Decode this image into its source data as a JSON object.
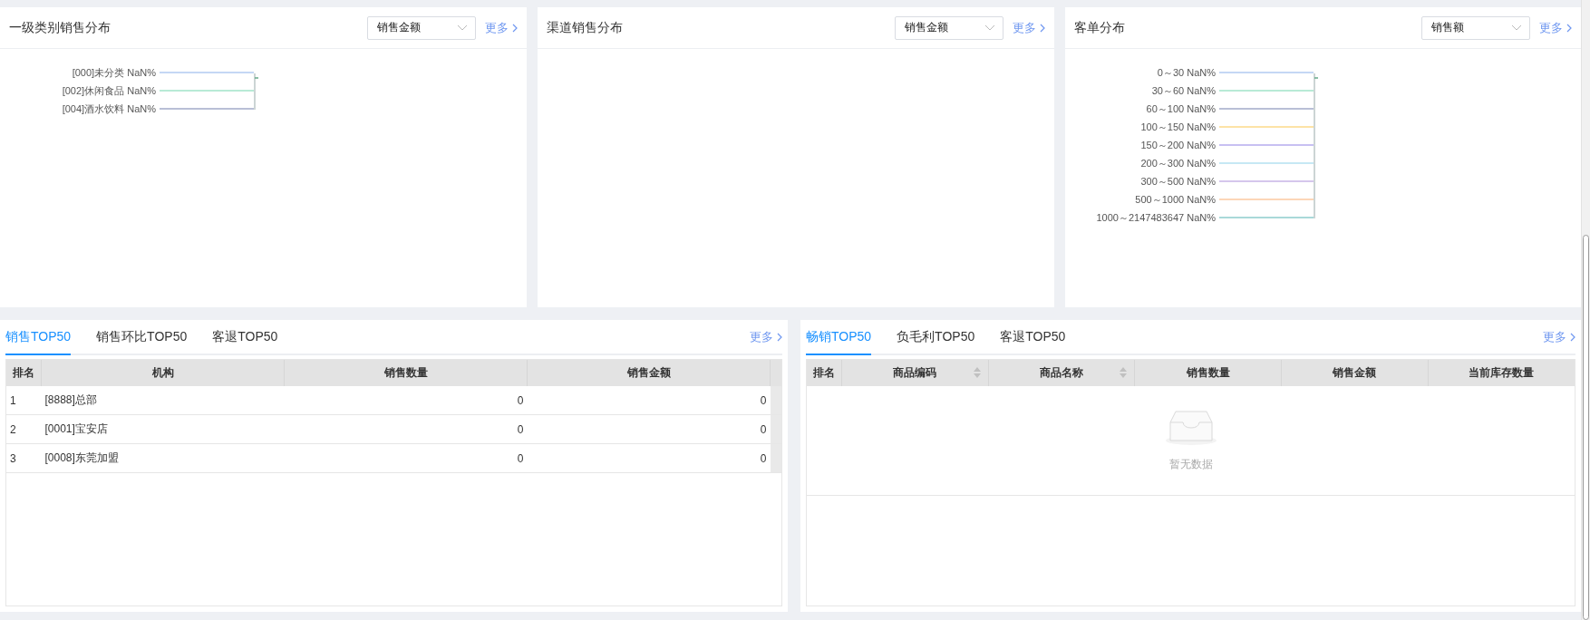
{
  "top_panels": [
    {
      "title": "一级类别销售分布",
      "select": {
        "value": "销售金额"
      },
      "more": "更多",
      "chart_labels": [
        {
          "label": "[000]未分类 NaN%",
          "color": "#c5d7f4"
        },
        {
          "label": "[002]休闲食品 NaN%",
          "color": "#b8ead6"
        },
        {
          "label": "[004]酒水饮料 NaN%",
          "color": "#b9bfd6"
        }
      ]
    },
    {
      "title": "渠道销售分布",
      "select": {
        "value": "销售金额"
      },
      "more": "更多"
    },
    {
      "title": "客单分布",
      "select": {
        "value": "销售额"
      },
      "more": "更多",
      "chart_labels": [
        {
          "label": "0～30 NaN%",
          "color": "#c5d7f4"
        },
        {
          "label": "30～60 NaN%",
          "color": "#b8ead6"
        },
        {
          "label": "60～100 NaN%",
          "color": "#b9bfd6"
        },
        {
          "label": "100～150 NaN%",
          "color": "#fde3a6"
        },
        {
          "label": "150～200 NaN%",
          "color": "#c8c0f2"
        },
        {
          "label": "200～300 NaN%",
          "color": "#c6e8f4"
        },
        {
          "label": "300～500 NaN%",
          "color": "#d5c6ec"
        },
        {
          "label": "500～1000 NaN%",
          "color": "#fcd6b8"
        },
        {
          "label": "1000～2147483647 NaN%",
          "color": "#a9d9d9"
        }
      ]
    }
  ],
  "bottom_panels": [
    {
      "more": "更多",
      "tabs": [
        {
          "label": "销售TOP50",
          "selected": true
        },
        {
          "label": "销售环比TOP50",
          "selected": false
        },
        {
          "label": "客退TOP50",
          "selected": false
        }
      ],
      "table": {
        "columns": [
          {
            "label": "排名",
            "sortable": false,
            "kind": "text"
          },
          {
            "label": "机构",
            "sortable": false,
            "kind": "text"
          },
          {
            "label": "销售数量",
            "sortable": false,
            "kind": "number"
          },
          {
            "label": "销售金额",
            "sortable": false,
            "kind": "number"
          }
        ],
        "rows": [
          [
            "1",
            "[8888]总部",
            "0",
            "0"
          ],
          [
            "2",
            "[0001]宝安店",
            "0",
            "0"
          ],
          [
            "3",
            "[0008]东莞加盟",
            "0",
            "0"
          ]
        ]
      }
    },
    {
      "more": "更多",
      "tabs": [
        {
          "label": "畅销TOP50",
          "selected": true
        },
        {
          "label": "负毛利TOP50",
          "selected": false
        },
        {
          "label": "客退TOP50",
          "selected": false
        }
      ],
      "table": {
        "columns": [
          {
            "label": "排名",
            "sortable": false
          },
          {
            "label": "商品编码",
            "sortable": true
          },
          {
            "label": "商品名称",
            "sortable": true
          },
          {
            "label": "销售数量",
            "sortable": false
          },
          {
            "label": "销售金额",
            "sortable": false
          },
          {
            "label": "当前库存数量",
            "sortable": false
          }
        ],
        "empty_text": "暂无数据"
      }
    }
  ]
}
